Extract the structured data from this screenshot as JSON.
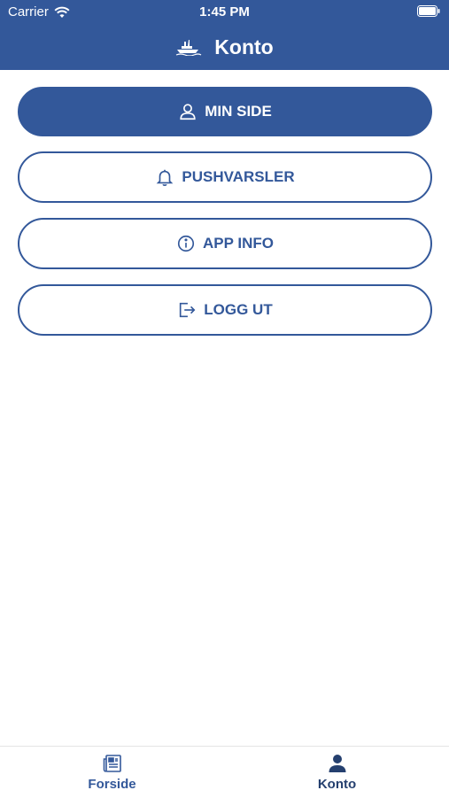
{
  "status_bar": {
    "carrier": "Carrier",
    "time": "1:45 PM"
  },
  "header": {
    "title": "Konto",
    "logo_icon": "ship-logo-icon"
  },
  "menu": {
    "items": [
      {
        "label": "MIN SIDE",
        "icon": "user-icon",
        "style": "filled"
      },
      {
        "label": "PUSHVARSLER",
        "icon": "bell-icon",
        "style": "outline"
      },
      {
        "label": "APP INFO",
        "icon": "info-icon",
        "style": "outline"
      },
      {
        "label": "LOGG UT",
        "icon": "logout-icon",
        "style": "outline"
      }
    ]
  },
  "tab_bar": {
    "tabs": [
      {
        "label": "Forside",
        "icon": "newspaper-icon",
        "active": false
      },
      {
        "label": "Konto",
        "icon": "person-icon",
        "active": true
      }
    ]
  },
  "colors": {
    "brand": "#33589a",
    "active_tab": "#25406f",
    "background": "#ffffff"
  }
}
